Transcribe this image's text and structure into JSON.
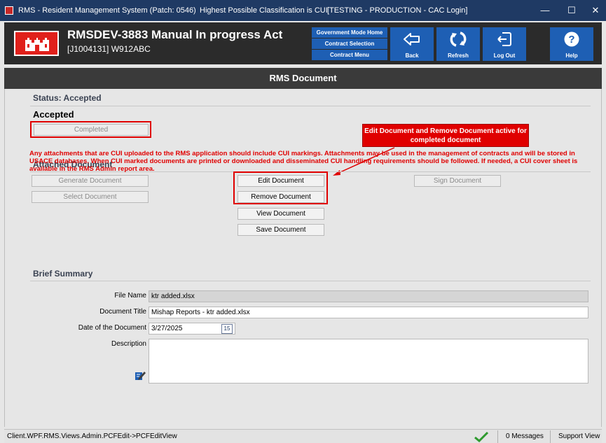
{
  "window": {
    "title": "RMS - Resident Management System (Patch: 0546)",
    "classification": "Highest Possible Classification is CUI",
    "environment": "[TESTING - PRODUCTION - CAC Login]",
    "minimize": "—",
    "maximize": "☐",
    "close": "✕"
  },
  "header": {
    "title": "RMSDEV-3883 Manual In progress Act",
    "subtitle": "[J1004131] W912ABC",
    "menu": [
      "Government Mode Home",
      "Contract Selection",
      "Contract Menu"
    ],
    "nav": [
      {
        "label": "Back",
        "icon": "back-arrow-icon"
      },
      {
        "label": "Refresh",
        "icon": "refresh-icon"
      },
      {
        "label": "Log Out",
        "icon": "logout-icon"
      },
      {
        "label": "Help",
        "icon": "help-icon"
      }
    ]
  },
  "section_title": "RMS Document",
  "status": {
    "heading": "Status: Accepted",
    "state": "Accepted",
    "completed_button": "Completed"
  },
  "callout": "Edit Document and Remove Document active for completed document",
  "attached": {
    "heading": "Attached Document",
    "generate": "Generate Document",
    "select": "Select Document",
    "edit": "Edit Document",
    "remove": "Remove Document",
    "view": "View Document",
    "save": "Save Document",
    "sign": "Sign Document"
  },
  "warning": "Any attachments that are CUI uploaded to the RMS application should include CUI markings.  Attachments may be used in the management of contracts and will be stored in USACE databases.  When CUI marked documents are printed or downloaded and disseminated CUI handling requirements should be followed. If needed, a CUI cover sheet is available in the RMS Admin report area.",
  "summary": {
    "heading": "Brief Summary",
    "file_name_label": "File Name",
    "file_name": "ktr added.xlsx",
    "doc_title_label": "Document Title",
    "doc_title": "Mishap Reports - ktr added.xlsx",
    "date_label": "Date of the Document",
    "date": "3/27/2025",
    "calendar_day": "15",
    "description_label": "Description",
    "description": ""
  },
  "statusbar": {
    "view": "Client.WPF.RMS.Views.Admin.PCFEdit->PCFEditView",
    "messages": "0 Messages",
    "support": "Support View"
  },
  "colors": {
    "accent_blue": "#1e5fb4",
    "highlight_red": "#e00000",
    "titlebar": "#1f3a64"
  }
}
